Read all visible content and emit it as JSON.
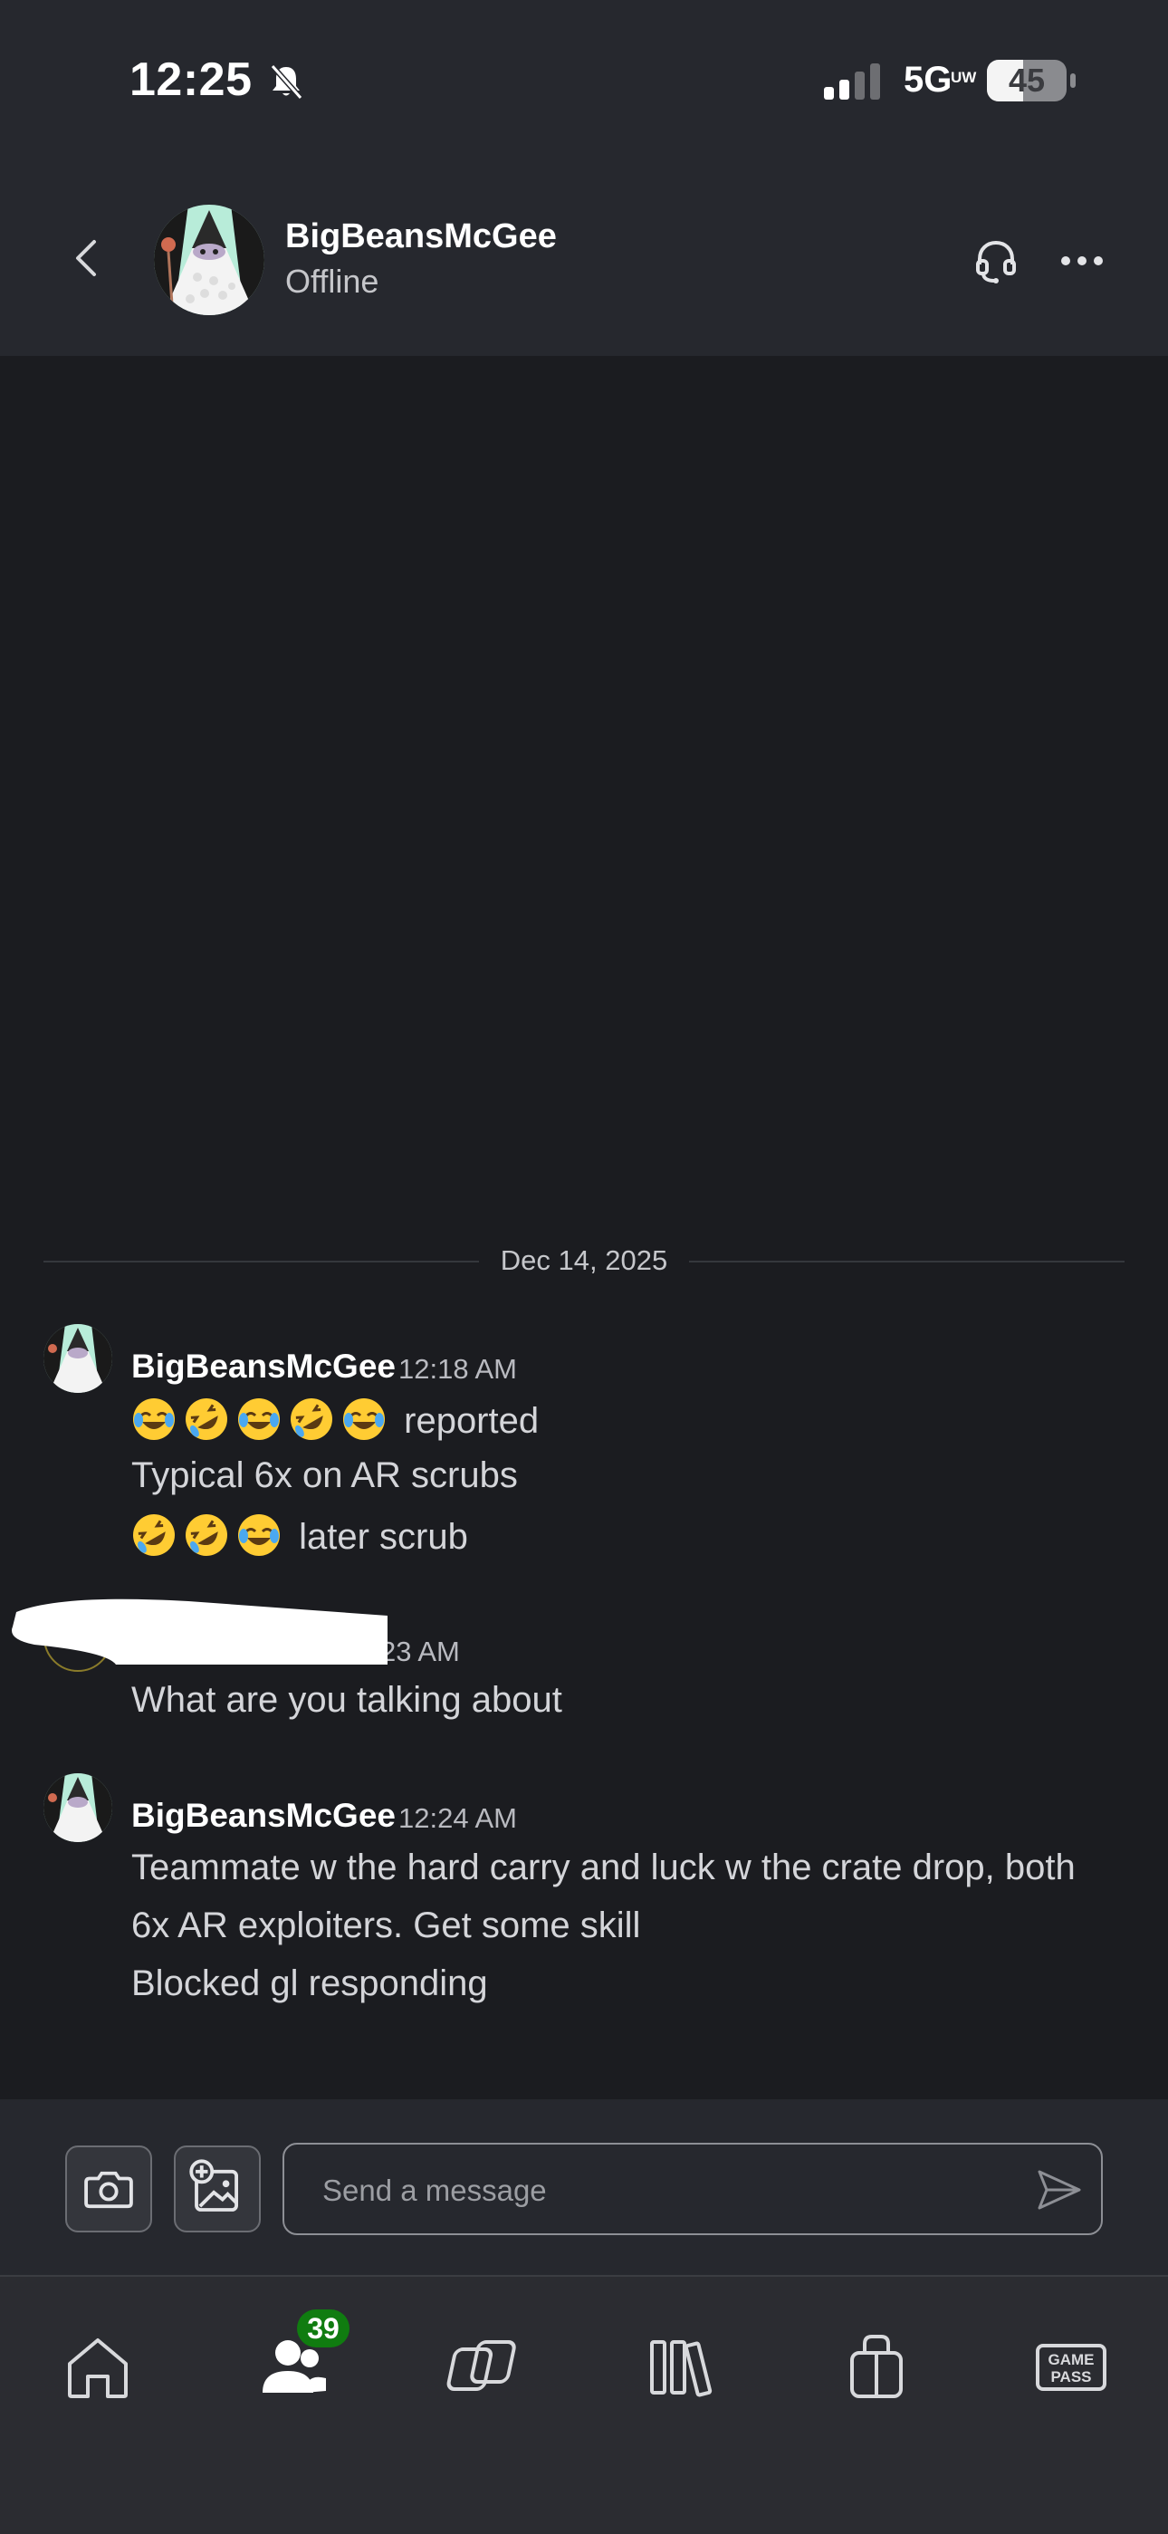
{
  "status_bar": {
    "time": "12:25",
    "network": "5G",
    "network_sub": "UW",
    "battery": "45",
    "battery_level": 0.45
  },
  "header": {
    "contact_name": "BigBeansMcGee",
    "contact_status": "Offline"
  },
  "chat": {
    "date_divider": "Dec 14, 2025",
    "messages": [
      {
        "sender": "BigBeansMcGee",
        "time": "12:18 AM",
        "lines": [
          {
            "emojis": [
              "joy",
              "rofl",
              "joy",
              "rofl",
              "joy"
            ],
            "text": "reported"
          },
          {
            "emojis": [],
            "text": "Typical 6x on AR scrubs"
          },
          {
            "emojis": [
              "rofl",
              "rofl",
              "joy"
            ],
            "text": "later scrub"
          }
        ]
      },
      {
        "sender": "",
        "time_visible": "23 AM",
        "lines": [
          {
            "emojis": [],
            "text": "What are you talking about"
          }
        ]
      },
      {
        "sender": "BigBeansMcGee",
        "time": "12:24 AM",
        "lines": [
          {
            "emojis": [],
            "text": "Teammate w the hard carry and luck w the crate drop, both"
          },
          {
            "emojis": [],
            "text": "6x AR exploiters. Get some skill"
          },
          {
            "emojis": [],
            "text": "Blocked gl responding"
          }
        ]
      }
    ]
  },
  "composer": {
    "placeholder": "Send a message"
  },
  "bottom_nav": {
    "items": [
      {
        "icon": "home-icon"
      },
      {
        "icon": "friends-icon",
        "badge": "39"
      },
      {
        "icon": "cloud-gaming-icon"
      },
      {
        "icon": "library-icon"
      },
      {
        "icon": "store-icon"
      },
      {
        "icon": "game-pass-icon",
        "label": "GAME\nPASS"
      }
    ]
  },
  "colors": {
    "background": "#1b1c20",
    "header": "#26282e",
    "badge": "#107c10"
  }
}
